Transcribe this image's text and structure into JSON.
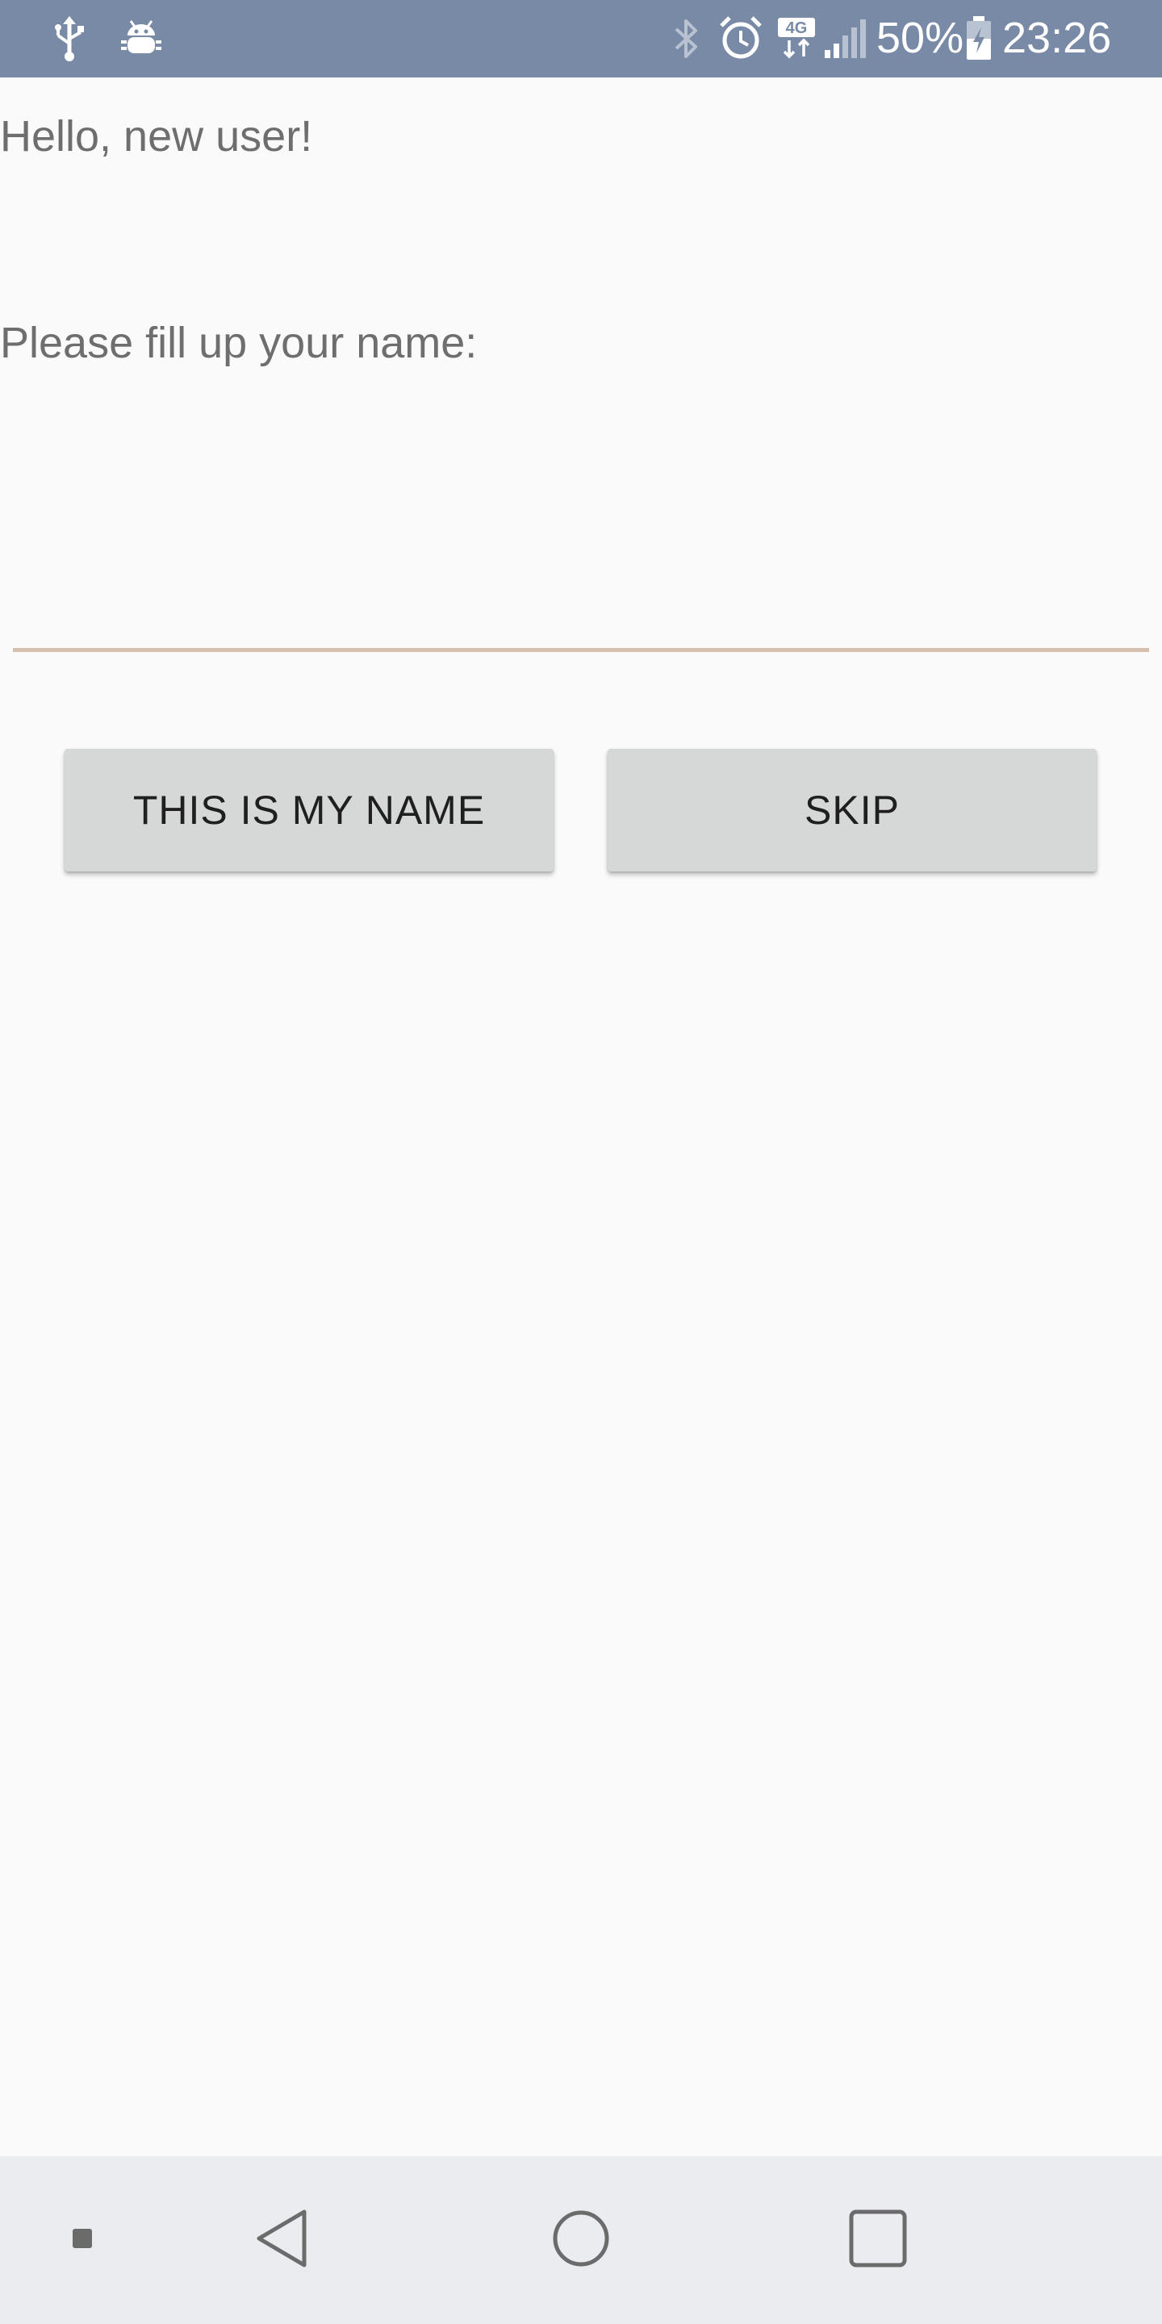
{
  "status_bar": {
    "background": "#798aa6",
    "left_icons": [
      "usb-icon",
      "android-debug-icon"
    ],
    "right_icons": [
      "bluetooth-icon",
      "alarm-icon",
      "4g-icon",
      "signal-icon",
      "battery-icon"
    ],
    "network_label": "4G",
    "battery_percent": "50%",
    "clock": "23:26"
  },
  "content": {
    "greeting": "Hello, new user!",
    "prompt": "Please fill up your name:",
    "name_input": {
      "value": "",
      "placeholder": ""
    },
    "buttons": {
      "confirm_label": "THIS IS MY NAME",
      "skip_label": "SKIP"
    }
  },
  "nav_bar": {
    "icons": [
      "menu-dot-icon",
      "back-icon",
      "home-icon",
      "recents-icon"
    ]
  },
  "colors": {
    "background": "#fafafa",
    "text": "#6e6e6e",
    "input_underline": "#d8c0ae",
    "button_bg": "#d6d7d7",
    "nav_bg": "#ebecef"
  }
}
